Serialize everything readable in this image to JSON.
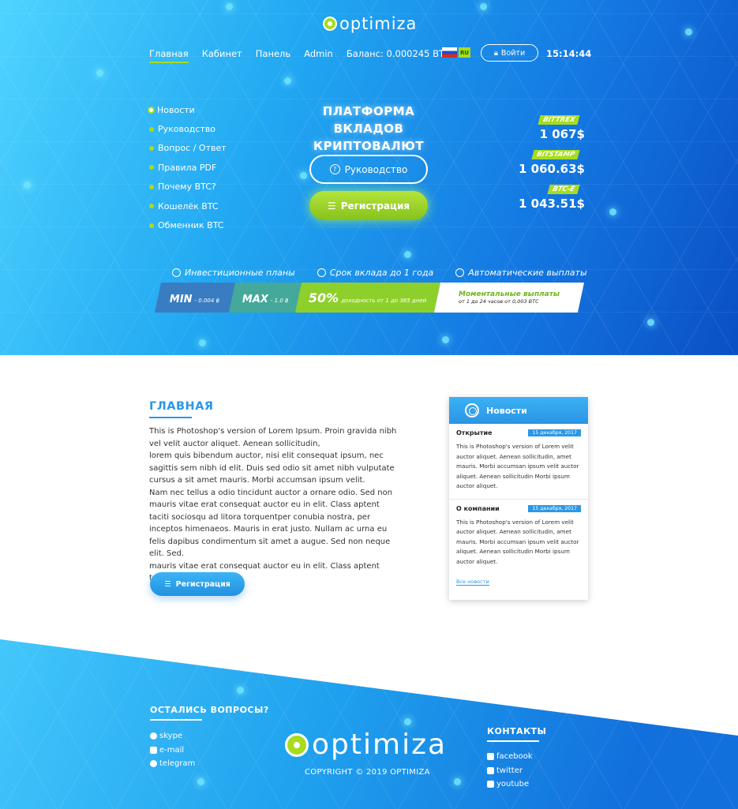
{
  "brand": {
    "name": "optimiza"
  },
  "nav": {
    "items": [
      "Главная",
      "Кабинет",
      "Панель",
      "Admin",
      "Баланс: 0.000245 BTC"
    ],
    "lang": "RU",
    "login_label": "Войти",
    "time": "15:14:44"
  },
  "side_menu": [
    "Новости",
    "Руководство",
    "Вопрос / Ответ",
    "Правила PDF",
    "Почему BTC?",
    "Кошелёк BTC",
    "Обменник BTC"
  ],
  "hero": {
    "headline_line1": "ПЛАТФОРМА ВКЛАДОВ",
    "headline_line2": "КРИПТОВАЛЮТ",
    "guide_label": "Руководство",
    "register_label": "Регистрация"
  },
  "rates": [
    {
      "exchange": "BITTREX",
      "value": "1 067$"
    },
    {
      "exchange": "BITSTAMP",
      "value": "1 060.63$"
    },
    {
      "exchange": "BTC-E",
      "value": "1 043.51$"
    }
  ],
  "features": {
    "headers": [
      "Инвестиционные планы",
      "Срок вклада до 1 года",
      "Автоматические выплаты"
    ],
    "min_label": "MIN",
    "min_value": "- 0.004 ฿",
    "max_label": "MAX",
    "max_value": "- 1.0 ฿",
    "percent": "50%",
    "percent_note": "доходность от 1 до 365 дней",
    "instant_title": "Моментальные выплаты",
    "instant_note": "от 1 до 24 часов от 0,003 BTC"
  },
  "main": {
    "title": "ГЛАВНАЯ",
    "text": "This is Photoshop's version  of Lorem Ipsum. Proin gravida nibh vel velit auctor aliquet. Aenean sollicitudin,\nlorem quis bibendum auctor, nisi elit consequat ipsum, nec sagittis sem nibh id elit. Duis sed odio sit amet nibh vulputate cursus a sit amet mauris. Morbi accumsan ipsum velit.\nNam nec tellus a odio tincidunt auctor a ornare odio. Sed non mauris vitae erat consequat auctor eu in elit. Class aptent taciti sociosqu ad litora torquentper conubia nostra, per inceptos himenaeos. Mauris in erat justo. Nullam ac urna eu felis dapibus condimentum sit amet a augue. Sed non neque elit. Sed.\nmauris vitae erat consequat auctor eu in elit. Class aptent taciti",
    "button_label": "Регистрация"
  },
  "news": {
    "title": "Новости",
    "items": [
      {
        "title": "Открытие",
        "date": "15 декабря, 2017",
        "body": "This is Photoshop's version  of Lorem velit auctor aliquet. Aenean sollicitudin, amet mauris. Morbi accumsan ipsum velit auctor aliquet. Aenean sollicitudin Morbi ipsum auctor aliquet."
      },
      {
        "title": "О компании",
        "date": "15 декабря, 2017",
        "body": "This is Photoshop's version  of Lorem velit auctor aliquet. Aenean sollicitudin, amet mauris. Morbi accumsan ipsum velit auctor aliquet. Aenean sollicitudin Morbi ipsum auctor aliquet."
      }
    ],
    "all_link": "Все новости"
  },
  "footer": {
    "questions_title": "ОСТАЛИСЬ ВОПРОСЫ?",
    "questions_links": [
      "skype",
      "e-mail",
      "telegram"
    ],
    "contacts_title": "КОНТАКТЫ",
    "contacts_links": [
      "facebook",
      "twitter",
      "youtube"
    ],
    "copyright": "COPYRIGHT © 2019 OPTIMIZA"
  },
  "colors": {
    "accent": "#a7dc1f",
    "primary": "#2a98e8"
  }
}
